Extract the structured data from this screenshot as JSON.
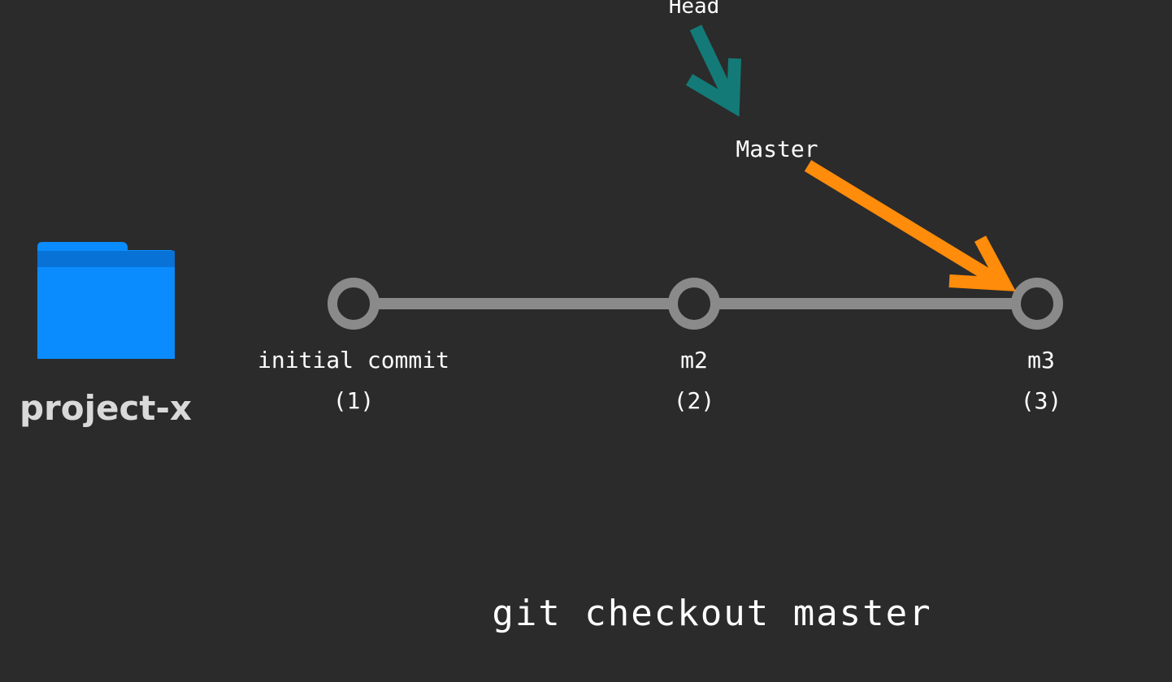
{
  "repo": {
    "folder_name": "project-x",
    "folder_icon": "folder-icon",
    "folder_color": "#0a8cff"
  },
  "pointers": {
    "head": {
      "label": "Head",
      "color": "#137a78"
    },
    "master": {
      "label": "Master",
      "color": "#ff8c0a"
    }
  },
  "commits": [
    {
      "message": "initial commit",
      "number": "(1)"
    },
    {
      "message": "m2",
      "number": "(2)"
    },
    {
      "message": "m3",
      "number": "(3)"
    }
  ],
  "command": "git checkout master",
  "timeline_color": "#8a8a8a"
}
